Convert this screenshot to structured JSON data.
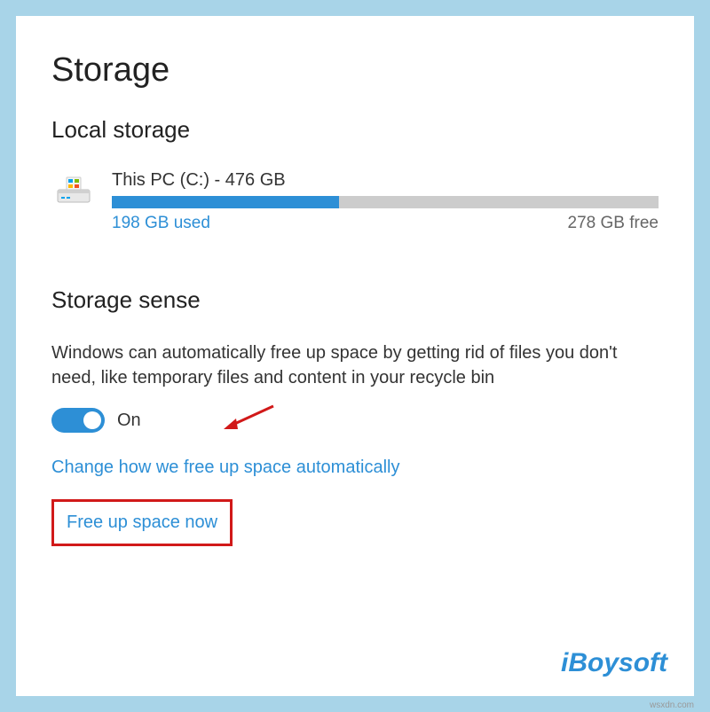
{
  "page": {
    "title": "Storage"
  },
  "local": {
    "heading": "Local storage",
    "drive": {
      "name": "This PC (C:) - 476 GB",
      "used_label": "198 GB used",
      "free_label": "278 GB free",
      "used_percent": 41.6
    }
  },
  "sense": {
    "heading": "Storage sense",
    "description": "Windows can automatically free up space by getting rid of files you don't need, like temporary files and content in your recycle bin",
    "toggle_state": "On",
    "link_auto": "Change how we free up space automatically",
    "link_now": "Free up space now"
  },
  "watermark": "iBoysoft",
  "footer": "wsxdn.com"
}
